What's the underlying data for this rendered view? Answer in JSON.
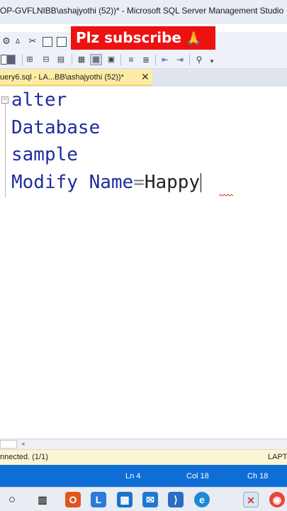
{
  "window": {
    "title": "OP-GVFLNIBB\\ashajyothi (52))* - Microsoft SQL Server Management Studio"
  },
  "banner": {
    "text": "Plz subscribe",
    "emoji": "🙏"
  },
  "toolbar1": {
    "icons": [
      "sql-analysis-icon",
      "dax-icon",
      "cut-icon",
      "copy-icon",
      "paste-icon",
      "undo-icon"
    ]
  },
  "toolbar2": {
    "icons": [
      "results-to-text-icon",
      "results-to-grid-icon",
      "parse-icon",
      "include-plan-icon",
      "results-to-file-icon",
      "comment-icon",
      "uncomment-icon",
      "indent-icon",
      "outdent-icon",
      "specify-values-icon"
    ]
  },
  "tab": {
    "label": "uery6.sql - LA...BB\\ashajyothi (52))*",
    "close": "✕"
  },
  "editor": {
    "lines": [
      "alter",
      "Database",
      "sample",
      "Modify Name"
    ],
    "op": "=",
    "identifier": "Happy",
    "collapse_glyph": "−"
  },
  "hscroll": {
    "zoom": "",
    "arrow": "◂"
  },
  "status": {
    "connection": "nnected. (1/1)",
    "server": "LAPTO",
    "ln": "Ln 4",
    "col": "Col 18",
    "ch": "Ch 18"
  },
  "taskbar": {
    "icons": [
      "search-circle-icon",
      "task-view-icon",
      "office-icon",
      "teams-l-icon",
      "store-icon",
      "mail-icon",
      "edge-icon",
      "vscode-icon",
      "ssms-icon",
      "chrome-icon"
    ]
  },
  "colors": {
    "keyword": "#1f2d9e",
    "banner": "#ee1111",
    "statusbar": "#0e6ed6",
    "tab_active": "#ffeca4"
  }
}
